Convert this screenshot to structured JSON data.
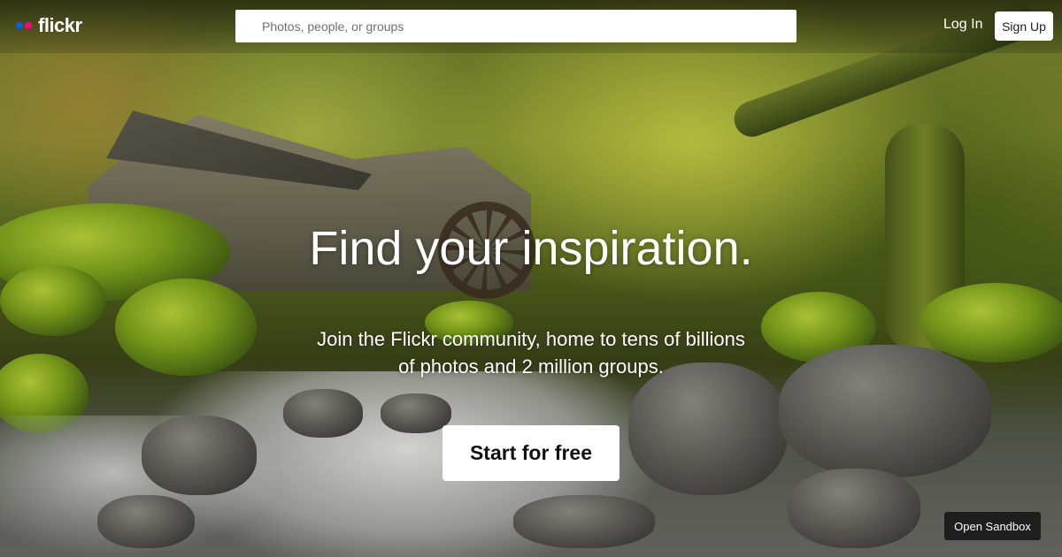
{
  "header": {
    "logo_text": "flickr",
    "logo_colors": {
      "blue": "#0063dc",
      "pink": "#ff0084"
    },
    "search": {
      "placeholder": "Photos, people, or groups",
      "value": ""
    },
    "login_label": "Log In",
    "signup_label": "Sign Up"
  },
  "hero": {
    "headline": "Find your inspiration.",
    "subline": "Join the Flickr community, home to tens of billions of photos and 2 million groups.",
    "cta_label": "Start for free"
  },
  "footer": {
    "sandbox_label": "Open Sandbox"
  }
}
